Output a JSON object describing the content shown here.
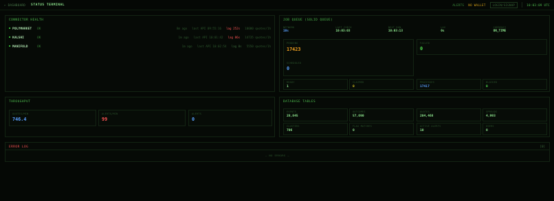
{
  "header": {
    "back": "← DASHBOARD",
    "title": "STATUS TERMINAL",
    "alerts": "ALERTS",
    "wallet": "NO WALLET",
    "login": "LOGIN/SIGNUP",
    "clock": "10:03:09 UTC"
  },
  "connectors": {
    "title": "CONNECTOR HEALTH",
    "rows": [
      {
        "name": "POLYMARKET",
        "status": "OK",
        "ago": "8m ago",
        "last": "last API 09:55:16",
        "lag": "lag 252s",
        "quotes": "10000 quotes/1h"
      },
      {
        "name": "KALSHI",
        "status": "OK",
        "ago": "1m ago",
        "last": "last API 10:01:42",
        "lag": "lag 86s",
        "quotes": "14735 quotes/1h"
      },
      {
        "name": "MANIFOLD",
        "status": "OK",
        "ago": "1m ago",
        "last": "last API 10:02:54",
        "lag": "lag 0s",
        "quotes": "5550 quotes/1h"
      }
    ]
  },
  "jobqueue": {
    "title": "JOB QUEUE (SOLID QUEUE)",
    "stats": [
      {
        "label": "NETWORK",
        "value": "10s"
      },
      {
        "label": "LAST CHECK",
        "value": "10:03:03"
      },
      {
        "label": "NEXT RUN",
        "value": "10:03:13"
      },
      {
        "label": "LAG",
        "value": "0s"
      },
      {
        "label": "CURRENCY",
        "value": "ON_TIME"
      }
    ],
    "pending_label": "PENDING",
    "pending_value": "17423",
    "failed_label": "FAILED",
    "failed_value": "0",
    "scheduled_label": "SCHEDULED",
    "scheduled_value": "0",
    "bottom": [
      {
        "label": "READY",
        "value": "1"
      },
      {
        "label": "CLAIMED",
        "value": "0"
      },
      {
        "label": "PROCESSES",
        "value": "17417"
      },
      {
        "label": "BLOCKED",
        "value": "0"
      }
    ]
  },
  "throughput": {
    "title": "THROUGHPUT",
    "items": [
      {
        "label": "QUOTES/MIN",
        "value": "746.4"
      },
      {
        "label": "ALERTS/MIN",
        "value": "99"
      },
      {
        "label": "ALERTS",
        "value": "0"
      }
    ]
  },
  "database": {
    "title": "DATABASE TABLES",
    "items": [
      {
        "label": "EVENTS",
        "value": "28,845"
      },
      {
        "label": "OUTCOMES",
        "value": "57,690"
      },
      {
        "label": "QUOTES",
        "value": "204,468"
      },
      {
        "label": "SPREADS",
        "value": "4,993"
      },
      {
        "label": "CLUSTERS",
        "value": "706"
      },
      {
        "label": "FLAG MATCHES",
        "value": "0"
      },
      {
        "label": "ACTIVE ALERTS",
        "value": "10"
      },
      {
        "label": "USERS",
        "value": "0"
      }
    ]
  },
  "errors": {
    "title": "ERROR LOG",
    "count": "[0]",
    "empty": "— NO ERRORS —"
  },
  "colors": {
    "accent": "#4fbf4f",
    "warning": "#f0a020",
    "error": "#ff5555",
    "info": "#5aa0ff"
  }
}
